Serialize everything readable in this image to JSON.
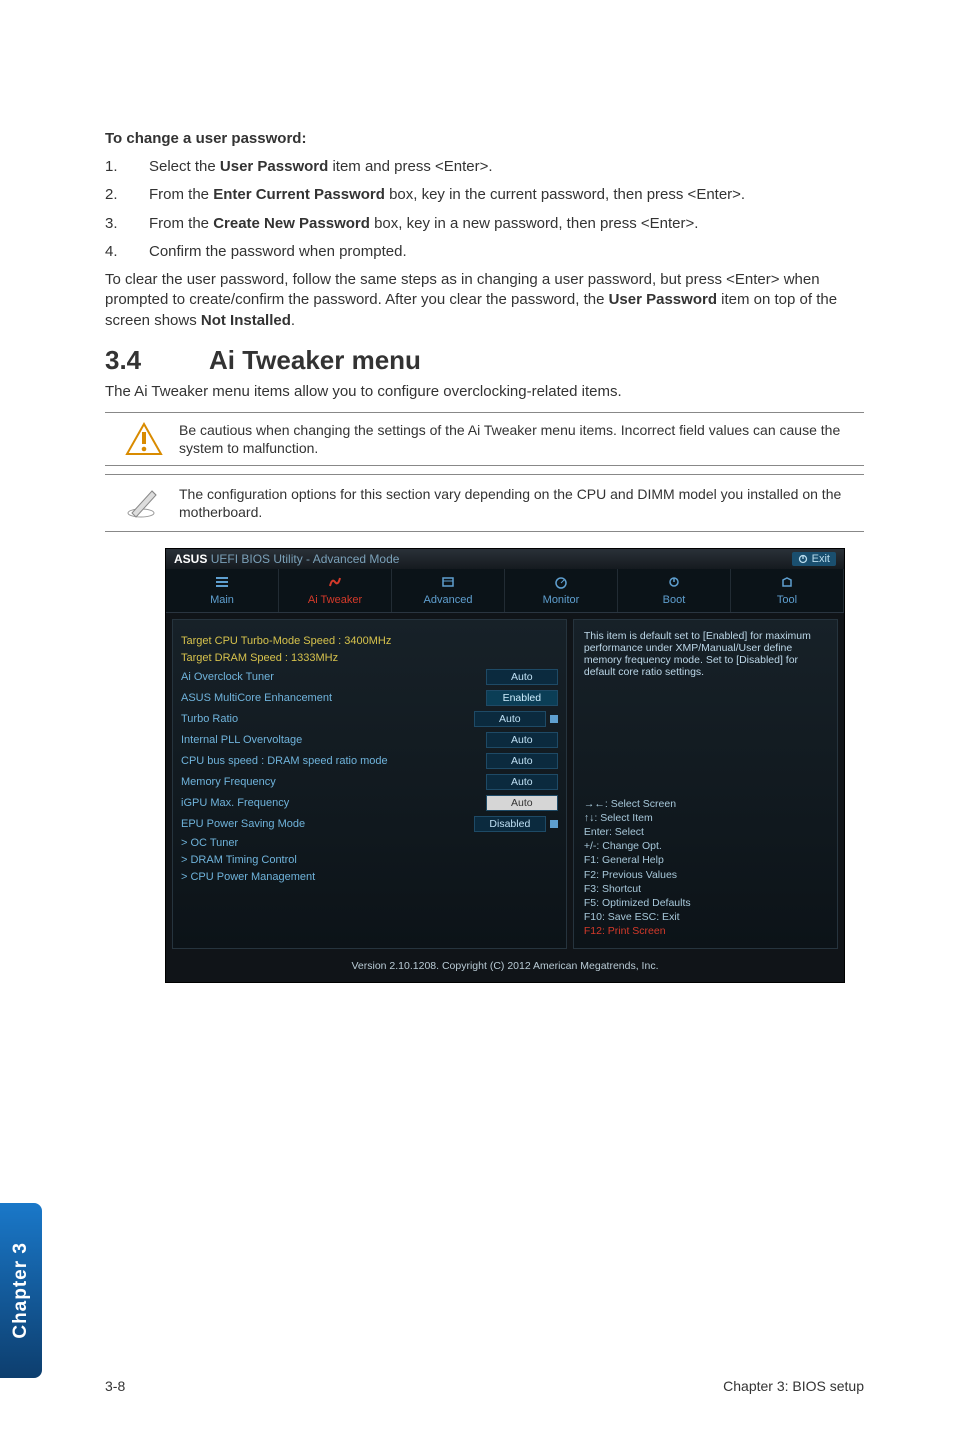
{
  "intro_heading": "To change a user password:",
  "steps": [
    {
      "num": "1.",
      "html": "Select the <b>User Password</b> item and press <Enter>."
    },
    {
      "num": "2.",
      "html": "From the <b>Enter Current Password</b> box, key in the current password, then press <Enter>."
    },
    {
      "num": "3.",
      "html": "From the <b>Create New Password</b> box, key in a new password, then press <Enter>."
    },
    {
      "num": "4.",
      "html": "Confirm the password when prompted."
    }
  ],
  "clear_text": "To clear the user password, follow the same steps as in changing a user password, but press <Enter> when prompted to create/confirm the password. After you clear the password, the <b>User Password</b> item on top of the screen shows <b>Not Installed</b>.",
  "section": {
    "num": "3.4",
    "title": "Ai Tweaker menu"
  },
  "section_desc": "The Ai Tweaker menu items allow you to configure overclocking-related items.",
  "notes": [
    "Be cautious when changing the settings of the Ai Tweaker menu items. Incorrect field values can cause the system to malfunction.",
    "The configuration options for this section vary depending on the CPU and DIMM model you installed on the motherboard."
  ],
  "bios": {
    "titlebar_brand": "ASUS",
    "titlebar_text": "UEFI BIOS Utility - Advanced Mode",
    "exit_label": "Exit",
    "tabs": [
      "Main",
      "Ai Tweaker",
      "Advanced",
      "Monitor",
      "Boot",
      "Tool"
    ],
    "rows": [
      {
        "label": "Target CPU Turbo-Mode Speed : 3400MHz",
        "field": "",
        "class": "yellow"
      },
      {
        "label": "Target DRAM Speed : 1333MHz",
        "field": "",
        "class": "yellow"
      },
      {
        "label": "Ai Overclock Tuner",
        "field": "Auto"
      },
      {
        "label": "ASUS MultiCore Enhancement",
        "field": "Enabled",
        "field_class": "enabled"
      },
      {
        "label": "Turbo Ratio",
        "field": "Auto",
        "scroll": true
      },
      {
        "label": "Internal PLL Overvoltage",
        "field": "Auto"
      },
      {
        "label": "CPU bus speed : DRAM speed ratio mode",
        "field": "Auto"
      },
      {
        "label": "Memory Frequency",
        "field": "Auto"
      },
      {
        "label": "iGPU Max. Frequency",
        "field": "Auto",
        "field_class": "highlight"
      },
      {
        "label": "EPU Power Saving Mode",
        "field": "Disabled",
        "scroll": true
      },
      {
        "label": "> OC Tuner",
        "field": ""
      },
      {
        "label": "> DRAM Timing Control",
        "field": ""
      },
      {
        "label": "> CPU Power Management",
        "field": ""
      }
    ],
    "help_top": "This item is default set to [Enabled] for maximum performance under XMP/Manual/User define memory frequency mode. Set to [Disabled] for default core ratio settings.",
    "help_bottom": [
      "→←: Select Screen",
      "↑↓: Select Item",
      "Enter: Select",
      "+/-: Change Opt.",
      "F1: General Help",
      "F2: Previous Values",
      "F3: Shortcut",
      "F5: Optimized Defaults",
      "F10: Save   ESC: Exit",
      "F12: Print Screen"
    ],
    "footer": "Version 2.10.1208. Copyright (C) 2012 American Megatrends, Inc."
  },
  "side_tab": "Chapter 3",
  "footer_left": "3-8",
  "footer_right": "Chapter 3: BIOS setup"
}
